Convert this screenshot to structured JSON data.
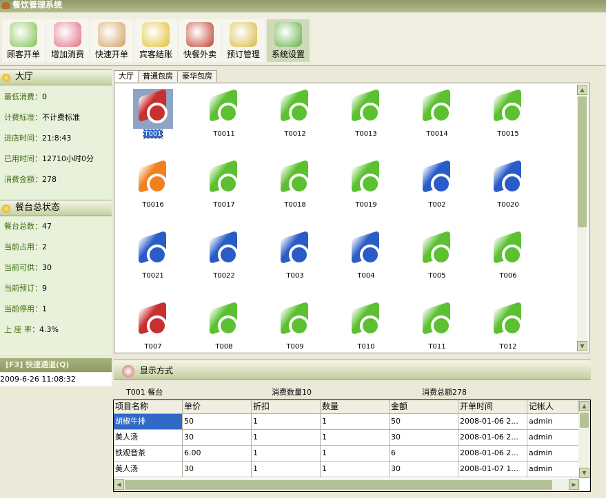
{
  "window": {
    "title": "餐饮管理系统"
  },
  "toolbar": [
    {
      "label": "顾客开单",
      "icon": "tea-cup-icon",
      "color": "#7fc050"
    },
    {
      "label": "增加消费",
      "icon": "add-icon",
      "color": "#e07080"
    },
    {
      "label": "快速开单",
      "icon": "pencil-book-icon",
      "color": "#d0a060"
    },
    {
      "label": "宾客结账",
      "icon": "dollar-arrow-icon",
      "color": "#e0c030"
    },
    {
      "label": "快餐外卖",
      "icon": "takeaway-icon",
      "color": "#c04030"
    },
    {
      "label": "预订管理",
      "icon": "clock-icon",
      "color": "#d8b840"
    },
    {
      "label": "系统设置",
      "icon": "gears-icon",
      "color": "#60b040"
    }
  ],
  "hall": {
    "title": "大厅",
    "rows": [
      {
        "k": "最低消费：",
        "v": "0"
      },
      {
        "k": "计费标准：",
        "v": "不计费标准"
      },
      {
        "k": "进店时间：",
        "v": "21:8:43"
      },
      {
        "k": "已用时间：",
        "v": "12710小时0分"
      },
      {
        "k": "消费金额：",
        "v": "278"
      }
    ]
  },
  "summary": {
    "title": "餐台总状态",
    "rows": [
      {
        "k": "餐台总数：",
        "v": "47"
      },
      {
        "k": "当前占用：",
        "v": "2"
      },
      {
        "k": "当前可供：",
        "v": "30"
      },
      {
        "k": "当前预订：",
        "v": "9"
      },
      {
        "k": "当前停用：",
        "v": "1"
      },
      {
        "k": "上 座 率：",
        "v": "4.3%"
      }
    ]
  },
  "quick": {
    "label": "[F3] 快速通道(Q)",
    "datetime": "2009-6-26 11:08:32"
  },
  "tabs": [
    {
      "label": "大厅",
      "selected": true
    },
    {
      "label": "普通包房"
    },
    {
      "label": "豪华包房"
    }
  ],
  "status_colors": {
    "free": "#5cc030",
    "occupied": "#c83030",
    "reserved": "#2a5cc8",
    "disabled": "#f08020"
  },
  "tables": [
    {
      "name": "T001",
      "status": "occupied",
      "selected": true
    },
    {
      "name": "T0011",
      "status": "free"
    },
    {
      "name": "T0012",
      "status": "free"
    },
    {
      "name": "T0013",
      "status": "free"
    },
    {
      "name": "T0014",
      "status": "free"
    },
    {
      "name": "T0015",
      "status": "free"
    },
    {
      "name": "T0016",
      "status": "disabled"
    },
    {
      "name": "T0017",
      "status": "free"
    },
    {
      "name": "T0018",
      "status": "free"
    },
    {
      "name": "T0019",
      "status": "free"
    },
    {
      "name": "T002",
      "status": "reserved"
    },
    {
      "name": "T0020",
      "status": "reserved"
    },
    {
      "name": "T0021",
      "status": "reserved"
    },
    {
      "name": "T0022",
      "status": "reserved"
    },
    {
      "name": "T003",
      "status": "reserved"
    },
    {
      "name": "T004",
      "status": "reserved"
    },
    {
      "name": "T005",
      "status": "free"
    },
    {
      "name": "T006",
      "status": "free"
    },
    {
      "name": "T007",
      "status": "occupied"
    },
    {
      "name": "T008",
      "status": "free"
    },
    {
      "name": "T009",
      "status": "free"
    },
    {
      "name": "T010",
      "status": "free"
    },
    {
      "name": "T011",
      "status": "free"
    },
    {
      "name": "T012",
      "status": "free"
    }
  ],
  "display": {
    "title": "显示方式",
    "table_label": "T001 餐台",
    "qty_label": "消费数量10",
    "total_label": "消费总额278"
  },
  "orders": {
    "columns": [
      "项目名称",
      "单价",
      "折扣",
      "数量",
      "金额",
      "开单时间",
      "记帐人"
    ],
    "rows": [
      [
        "胡椒牛排",
        "50",
        "1",
        "1",
        "50",
        "2008-01-06 2...",
        "admin"
      ],
      [
        "美人汤",
        "30",
        "1",
        "1",
        "30",
        "2008-01-06 2...",
        "admin"
      ],
      [
        "铁观音茶",
        "6.00",
        "1",
        "1",
        "6",
        "2008-01-06 2...",
        "admin"
      ],
      [
        "美人汤",
        "30",
        "1",
        "1",
        "30",
        "2008-01-07 1...",
        "admin"
      ]
    ]
  }
}
